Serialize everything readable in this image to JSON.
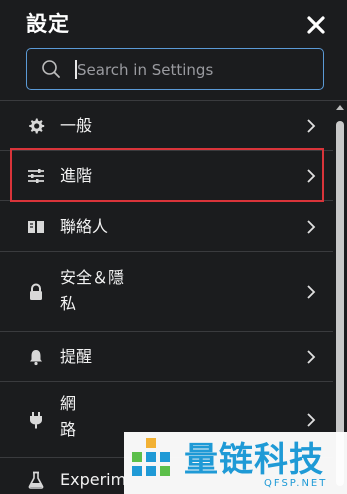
{
  "header": {
    "title": "設定",
    "close_icon": "close-icon"
  },
  "search": {
    "placeholder": "Search in Settings",
    "value": ""
  },
  "items": [
    {
      "label": "一般",
      "icon": "gear-icon"
    },
    {
      "label": "進階",
      "icon": "sliders-icon"
    },
    {
      "label": "聯絡人",
      "icon": "address-book-icon"
    },
    {
      "label_line1": "安全＆隱",
      "label_line2": "私",
      "icon": "lock-icon"
    },
    {
      "label": "提醒",
      "icon": "bell-icon"
    },
    {
      "label_line1": "網",
      "label_line2": "路",
      "icon": "plug-icon"
    },
    {
      "label": "Experim",
      "icon": "flask-icon"
    }
  ],
  "watermark": {
    "text": "量链科技",
    "sub": "QFSP.NET"
  },
  "colors": {
    "background": "#1b1c1e",
    "highlight": "#d9343a",
    "search_border": "#5b9ad6",
    "watermark": "#1f9ad6"
  }
}
